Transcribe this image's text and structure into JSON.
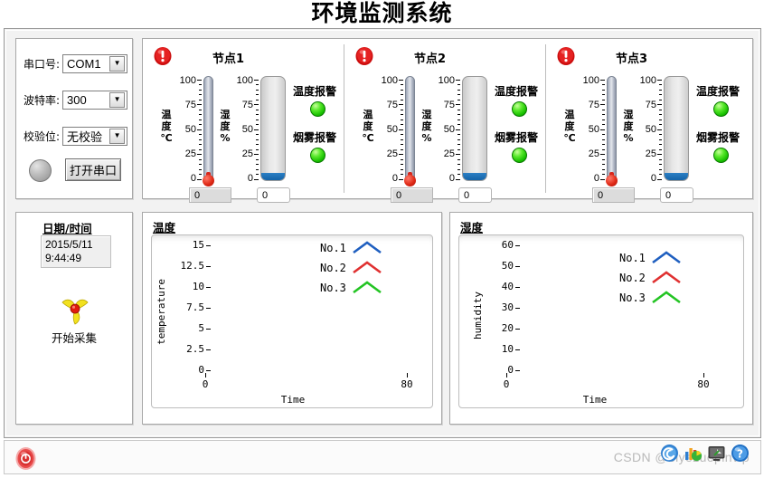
{
  "title": "环境监测系统",
  "serial": {
    "fields": [
      {
        "label": "串口号:",
        "value": "COM1"
      },
      {
        "label": "波特率:",
        "value": "300"
      },
      {
        "label": "校验位:",
        "value": "无校验"
      }
    ],
    "open_button": "打开串口",
    "status_led_name": "serial-status-led"
  },
  "datetime": {
    "heading": "日期/时间",
    "date": "2015/5/11",
    "time": "9:44:49",
    "acquire_label": "开始采集"
  },
  "nodes": [
    {
      "title": "节点1",
      "temperature": {
        "unit_label": "温\n度\n℃",
        "ticks": [
          "100",
          "75",
          "50",
          "25",
          "0"
        ],
        "value": "0"
      },
      "humidity": {
        "unit_label": "湿\n度\n%",
        "ticks": [
          "100",
          "75",
          "50",
          "25",
          "0"
        ],
        "value": "0"
      },
      "alarms": [
        {
          "label": "温度报警",
          "state": "on"
        },
        {
          "label": "烟雾报警",
          "state": "on"
        }
      ]
    },
    {
      "title": "节点2",
      "temperature": {
        "unit_label": "温\n度\n℃",
        "ticks": [
          "100",
          "75",
          "50",
          "25",
          "0"
        ],
        "value": "0"
      },
      "humidity": {
        "unit_label": "湿\n度\n%",
        "ticks": [
          "100",
          "75",
          "50",
          "25",
          "0"
        ],
        "value": "0"
      },
      "alarms": [
        {
          "label": "温度报警",
          "state": "on"
        },
        {
          "label": "烟雾报警",
          "state": "on"
        }
      ]
    },
    {
      "title": "节点3",
      "temperature": {
        "unit_label": "温\n度\n℃",
        "ticks": [
          "100",
          "75",
          "50",
          "25",
          "0"
        ],
        "value": "0"
      },
      "humidity": {
        "unit_label": "湿\n度\n%",
        "ticks": [
          "100",
          "75",
          "50",
          "25",
          "0"
        ],
        "value": "0"
      },
      "alarms": [
        {
          "label": "温度报警",
          "state": "on"
        },
        {
          "label": "烟雾报警",
          "state": "on"
        }
      ]
    }
  ],
  "chart_data": [
    {
      "type": "line",
      "title": "温度",
      "xlabel": "Time",
      "ylabel": "temperature",
      "xlim": [
        0,
        80
      ],
      "ylim": [
        0,
        15
      ],
      "xticks": [
        0,
        80
      ],
      "yticks": [
        0,
        2.5,
        5,
        7.5,
        10,
        12.5,
        15
      ],
      "ytick_labels": [
        "0",
        "2.5",
        "5",
        "7.5",
        "10",
        "12.5",
        "15"
      ],
      "xtick_labels": [
        "0",
        "80"
      ],
      "grid": false,
      "legend_position": "top-right",
      "series": [
        {
          "name": "No.1",
          "color": "#1f5fc0",
          "values": []
        },
        {
          "name": "No.2",
          "color": "#e03030",
          "values": []
        },
        {
          "name": "No.3",
          "color": "#23c423",
          "values": []
        }
      ]
    },
    {
      "type": "line",
      "title": "湿度",
      "xlabel": "Time",
      "ylabel": "humidity",
      "xlim": [
        0,
        80
      ],
      "ylim": [
        0,
        60
      ],
      "xticks": [
        0,
        80
      ],
      "yticks": [
        0,
        10,
        20,
        30,
        40,
        50,
        60
      ],
      "ytick_labels": [
        "0",
        "10",
        "20",
        "30",
        "40",
        "50",
        "60"
      ],
      "xtick_labels": [
        "0",
        "80"
      ],
      "grid": false,
      "legend_position": "top-right",
      "series": [
        {
          "name": "No.1",
          "color": "#1f5fc0",
          "values": []
        },
        {
          "name": "No.2",
          "color": "#e03030",
          "values": []
        },
        {
          "name": "No.3",
          "color": "#23c423",
          "values": []
        }
      ]
    }
  ],
  "statusbar": {
    "watermark": "CSDN @biyezuopinvip",
    "power_button_name": "power-button",
    "tray": [
      "web-icon",
      "chart-icon",
      "monitor-icon",
      "help-icon"
    ]
  },
  "colors": {
    "accent_blue": "#1f5fc0",
    "accent_red": "#e03030",
    "accent_green": "#23c423",
    "alarm_red": "#d8261a",
    "tank_fill": "#1b6fb5"
  }
}
